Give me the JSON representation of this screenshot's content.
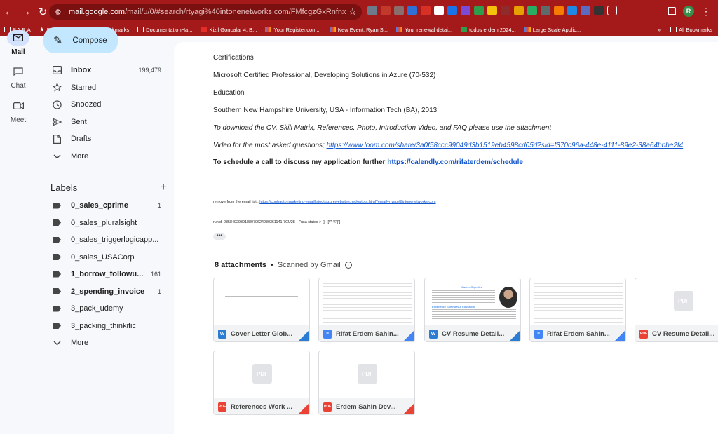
{
  "browser": {
    "url_host": "mail.google.com",
    "url_path": "/mail/u/0/#search/rtyagi%40intonenetworks.com/FMfcgzGxRnfnxLTkHwnWFktxhKM...",
    "bookmarks": [
      {
        "label": "P.A.R.A",
        "icon": "folder-icon"
      },
      {
        "label": "Bookmarks",
        "icon": "star-icon"
      },
      {
        "label": "OpenBookmarks",
        "icon": "folder-icon"
      },
      {
        "label": "DocumentationHa...",
        "icon": "folder-icon"
      },
      {
        "label": "Kizil Goncalar 4. B...",
        "icon": "youtube-icon"
      },
      {
        "label": "Your Register.com...",
        "icon": "gmail-icon"
      },
      {
        "label": "New Event: Ryan S...",
        "icon": "gmail-icon"
      },
      {
        "label": "Your renewal detai...",
        "icon": "gmail-icon"
      },
      {
        "label": "todos erdem 2024...",
        "icon": "sheets-icon"
      },
      {
        "label": "Large Scale Applic...",
        "icon": "gmail-icon"
      }
    ],
    "bookmarks_more": "»",
    "all_bookmarks": "All Bookmarks",
    "profile_initial": "R"
  },
  "rail": {
    "mail": "Mail",
    "chat": "Chat",
    "meet": "Meet"
  },
  "nav": {
    "compose": "Compose",
    "items": [
      {
        "label": "Inbox",
        "count": "199,479",
        "icon": "inbox-icon"
      },
      {
        "label": "Starred",
        "count": "",
        "icon": "star-icon"
      },
      {
        "label": "Snoozed",
        "count": "",
        "icon": "clock-icon"
      },
      {
        "label": "Sent",
        "count": "",
        "icon": "send-icon"
      },
      {
        "label": "Drafts",
        "count": "",
        "icon": "file-icon"
      },
      {
        "label": "More",
        "count": "",
        "icon": "chevron-down-icon"
      }
    ],
    "labels_title": "Labels",
    "labels_add": "+",
    "labels": [
      {
        "label": "0_sales_cprime",
        "count": "1"
      },
      {
        "label": "0_sales_pluralsight",
        "count": ""
      },
      {
        "label": "0_sales_triggerlogicapp...",
        "count": ""
      },
      {
        "label": "0_sales_USACorp",
        "count": ""
      },
      {
        "label": "1_borrow_followu...",
        "count": "161"
      },
      {
        "label": "2_spending_invoice",
        "count": "1"
      },
      {
        "label": "3_pack_udemy",
        "count": ""
      },
      {
        "label": "3_packing_thinkific",
        "count": ""
      }
    ],
    "labels_more": "More"
  },
  "email": {
    "certifications_heading": "Certifications",
    "certification": "Microsoft Certified Professional, Developing Solutions in Azure (70-532)",
    "education_heading": "Education",
    "education": "Southern New Hampshire University, USA - Information Tech (BA), 2013",
    "download_note": "To download the CV, Skill Matrix, References, Photo, Introduction Video, and FAQ please use the attachment",
    "video_prefix": "Video for the most asked questions; ",
    "video_link": "https://www.loom.com/share/3a0f58ccc99049d3b1519eb4598cd05d?sid=f370c96a-448e-4111-89e2-38a64bbbe2f4",
    "schedule_prefix": "To schedule a call to discuss my application further ",
    "schedule_link": "https://calendly.com/rifaterdem/schedule",
    "remove_prefix": "remove from the email list : ",
    "remove_link": "https://contractormarketing-emaillistout.azurewebsites.net/optout.html?email=rtyagi@intonenetworks.com",
    "runid": "runid: 0858492989188070624080361141 7CU28 - [\"usa states > [] - [\\\"\\ \\\\\"]\"]",
    "ellipsis": "•••"
  },
  "attachments": {
    "count_label": "8 attachments",
    "separator": " • ",
    "scanned_label": "Scanned by Gmail",
    "files": [
      {
        "name": "Cover Letter Glob...",
        "type": "word",
        "badge": "W"
      },
      {
        "name": "Rifat Erdem Sahin...",
        "type": "doc",
        "badge": "≡"
      },
      {
        "name": "CV Resume Detail...",
        "type": "word",
        "badge": "W"
      },
      {
        "name": "Rifat Erdem Sahin...",
        "type": "doc",
        "badge": "≡"
      },
      {
        "name": "CV Resume Detail...",
        "type": "pdf",
        "badge": "PDF"
      },
      {
        "name": "References Work ...",
        "type": "pdf",
        "badge": "PDF"
      },
      {
        "name": "Erdem Sahin Dev...",
        "type": "pdf",
        "badge": "PDF"
      }
    ],
    "pdf_placeholder": "PDF",
    "cv_preview_title": "Career Objective",
    "cv_preview_section": "Experience Summary & Education"
  },
  "colors": {
    "chrome_red": "#a41a1a",
    "link_blue": "#1155cc",
    "compose_bg": "#c2e7ff",
    "active_rail": "#d3e3fd"
  }
}
